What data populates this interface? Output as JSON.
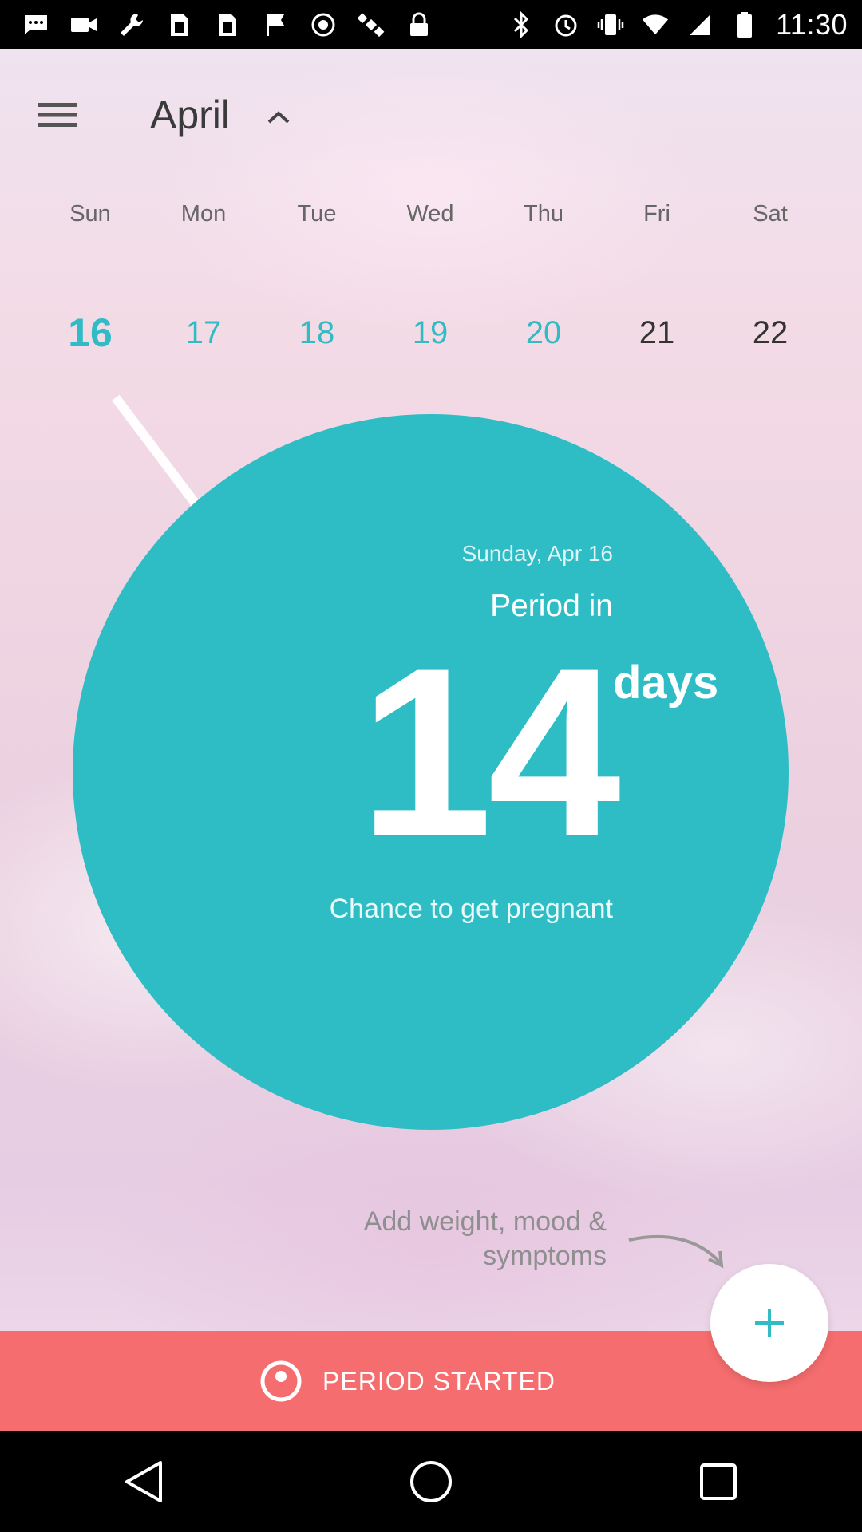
{
  "status_bar": {
    "time": "11:30",
    "left_icons": [
      "messages-icon",
      "video-icon",
      "wrench-icon",
      "sim-card-icon",
      "sim-card-icon",
      "flag-icon",
      "record-icon",
      "satellite-icon",
      "lock-icon"
    ],
    "right_icons": [
      "bluetooth-icon",
      "alarm-icon",
      "vibrate-icon",
      "wifi-icon",
      "signal-icon",
      "battery-icon"
    ]
  },
  "header": {
    "month": "April",
    "menu_icon": "hamburger-menu-icon",
    "toggle_icon": "chevron-up-icon"
  },
  "calendar": {
    "weekdays": [
      "Sun",
      "Mon",
      "Tue",
      "Wed",
      "Thu",
      "Fri",
      "Sat"
    ],
    "days": [
      "16",
      "17",
      "18",
      "19",
      "20",
      "21",
      "22"
    ],
    "selected_day": "16"
  },
  "summary": {
    "date": "Sunday, Apr 16",
    "label": "Period in",
    "count": "14",
    "unit": "days",
    "chance": "Chance to get pregnant"
  },
  "hint": {
    "line1": "Add weight, mood &",
    "line2": "symptoms"
  },
  "fab": {
    "icon": "plus-icon"
  },
  "period_button": {
    "label": "PERIOD STARTED",
    "icon": "target-icon"
  },
  "nav": {
    "back_icon": "back-icon",
    "home_icon": "home-icon",
    "recents_icon": "recents-icon"
  },
  "colors": {
    "accent": "#2ebdc5",
    "period_bar": "#f56d6e",
    "text_dark": "#3a3a3a"
  }
}
